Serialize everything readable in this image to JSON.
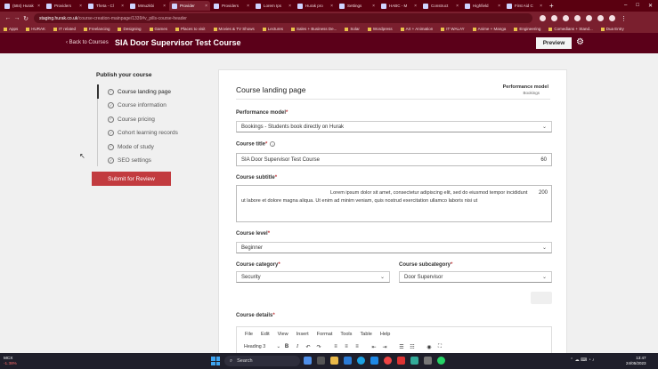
{
  "browser": {
    "tabs": [
      {
        "label": "(584) Hurak",
        "active": false
      },
      {
        "label": "Providers",
        "active": false
      },
      {
        "label": "Theta - Cl",
        "active": false
      },
      {
        "label": "Mmuzkbi",
        "active": false
      },
      {
        "label": "Provider",
        "active": true
      },
      {
        "label": "Providers",
        "active": false
      },
      {
        "label": "Lorem Ips",
        "active": false
      },
      {
        "label": "Hurak pro",
        "active": false
      },
      {
        "label": "Settings",
        "active": false
      },
      {
        "label": "HABC - M",
        "active": false
      },
      {
        "label": "Construct",
        "active": false
      },
      {
        "label": "Highfield",
        "active": false
      },
      {
        "label": "First Aid C",
        "active": false
      }
    ],
    "new_tab_label": "+",
    "url_host": "staging.hurak.co.uk",
    "url_path": "/course-creation-mainpage/1339#v_pills-course-header",
    "bookmarks": [
      "Apps",
      "HURAK",
      "IT related",
      "Freelancing",
      "Designing",
      "Games",
      "Places to visit",
      "Movies & TV Shows",
      "Lectures",
      "Sales + Business De...",
      "Solar",
      "Wordpress",
      "Art + Animation",
      "IT WALAY",
      "Anime + Manga",
      "Engineering",
      "Comedians + Stand...",
      "Dua Entry"
    ]
  },
  "header": {
    "back_label": "Back to Courses",
    "course_title": "SIA Door Supervisor Test Course",
    "preview_label": "Preview"
  },
  "sidebar": {
    "title": "Publish your course",
    "steps": [
      {
        "label": "Course landing page",
        "current": true
      },
      {
        "label": "Course information",
        "current": false
      },
      {
        "label": "Course pricing",
        "current": false
      },
      {
        "label": "Cohort learning records",
        "current": false
      },
      {
        "label": "Mode of study",
        "current": false
      },
      {
        "label": "SEO settings",
        "current": false
      }
    ],
    "submit_label": "Submit for Review"
  },
  "card": {
    "title": "Course landing page",
    "pm_label": "Performance model",
    "pm_value": "Bookings",
    "performance_model": {
      "label": "Performance model",
      "value": "Bookings - Students book directly on Hurak"
    },
    "course_title": {
      "label": "Course title",
      "value": "SIA Door Supervisor Test Course",
      "count": "60"
    },
    "course_subtitle": {
      "label": "Course subtitle",
      "value": "Lorem ipsum dolor sit amet, consectetur adipiscing elit, sed do eiusmod tempor incididunt ut labore et dolore magna aliqua. Ut enim ad minim veniam, quis nostrud exercitation ullamco laboris nisi ut",
      "count": "200"
    },
    "course_level": {
      "label": "Course level",
      "value": "Beginner"
    },
    "course_category": {
      "label": "Course category",
      "value": "Security"
    },
    "course_subcategory": {
      "label": "Course subcategory",
      "value": "Door Supervisor"
    },
    "course_details": {
      "label": "Course details",
      "menu": [
        "File",
        "Edit",
        "View",
        "Insert",
        "Format",
        "Tools",
        "Table",
        "Help"
      ],
      "heading_select": "Heading 3"
    }
  },
  "taskbar": {
    "weather_name": "MCX",
    "weather_change": "-1.38%",
    "search_label": "Search",
    "time": "13:47",
    "date": "24/05/2023"
  }
}
